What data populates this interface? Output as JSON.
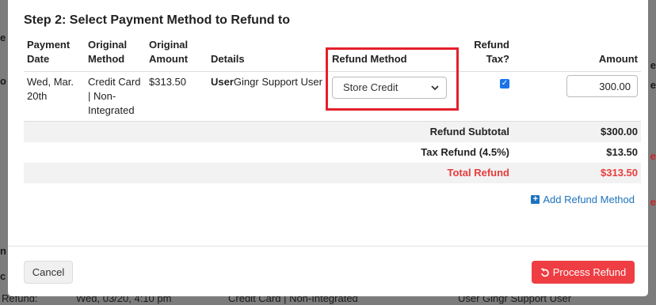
{
  "modal": {
    "title": "Step 2: Select Payment Method to Refund to",
    "columns": {
      "payment_date": "Payment Date",
      "original_method": "Original Method",
      "original_amount": "Original Amount",
      "details": "Details",
      "refund_method": "Refund Method",
      "refund_tax": "Refund Tax?",
      "amount": "Amount"
    },
    "row": {
      "payment_date": "Wed, Mar. 20th",
      "original_method": "Credit Card | Non-Integrated",
      "original_amount": "$313.50",
      "details_user_bold": "User",
      "details_user": "Gingr Support User",
      "refund_method_selected": "Store Credit",
      "refund_tax_checked": true,
      "amount_value": "300.00"
    },
    "summary": {
      "subtotal_label": "Refund Subtotal",
      "subtotal_value": "$300.00",
      "tax_label": "Tax Refund (4.5%)",
      "tax_value": "$13.50",
      "total_label": "Total Refund",
      "total_value": "$313.50"
    },
    "add_refund_method_label": "Add Refund Method",
    "cancel_label": "Cancel",
    "process_refund_label": "Process Refund"
  },
  "background": {
    "row_date": "Wed, 03/20, 4:10 pm",
    "row_method": "Credit Card | Non-Integrated",
    "row_user": "User Gingr Support User",
    "row_left": "Refund:"
  },
  "colors": {
    "accent": "#1e73be",
    "danger": "#ee3e43",
    "highlight": "#e4202b"
  }
}
